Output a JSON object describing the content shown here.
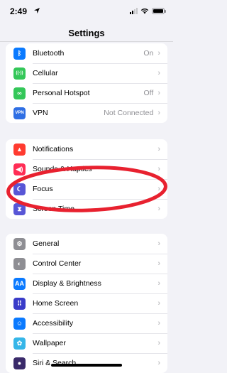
{
  "status_bar": {
    "time": "2:49"
  },
  "nav": {
    "title": "Settings"
  },
  "groups": [
    [
      {
        "name": "bluetooth",
        "label": "Bluetooth",
        "value": "On",
        "color": "#0a7aff",
        "icon": "bluetooth-icon",
        "glyph": "ᛒ"
      },
      {
        "name": "cellular",
        "label": "Cellular",
        "value": "",
        "color": "#34c759",
        "icon": "antenna-icon",
        "glyph": "((·))"
      },
      {
        "name": "personal-hotspot",
        "label": "Personal Hotspot",
        "value": "Off",
        "color": "#34c759",
        "icon": "link-icon",
        "glyph": "∞"
      },
      {
        "name": "vpn",
        "label": "VPN",
        "value": "Not Connected",
        "color": "#2f6fe4",
        "icon": "vpn-icon",
        "glyph": "VPN"
      }
    ],
    [
      {
        "name": "notifications",
        "label": "Notifications",
        "value": "",
        "color": "#ff3b30",
        "icon": "bell-icon",
        "glyph": "▲"
      },
      {
        "name": "sounds-haptics",
        "label": "Sounds & Haptics",
        "value": "",
        "color": "#ff2d55",
        "icon": "speaker-icon",
        "glyph": "◀)"
      },
      {
        "name": "focus",
        "label": "Focus",
        "value": "",
        "color": "#5856d6",
        "icon": "moon-icon",
        "glyph": "☾"
      },
      {
        "name": "screen-time",
        "label": "Screen Time",
        "value": "",
        "color": "#5856d6",
        "icon": "hourglass-icon",
        "glyph": "⧗"
      }
    ],
    [
      {
        "name": "general",
        "label": "General",
        "value": "",
        "color": "#8e8e93",
        "icon": "gear-icon",
        "glyph": "⚙"
      },
      {
        "name": "control-center",
        "label": "Control Center",
        "value": "",
        "color": "#8e8e93",
        "icon": "toggles-icon",
        "glyph": "◐"
      },
      {
        "name": "display-brightness",
        "label": "Display & Brightness",
        "value": "",
        "color": "#0a7aff",
        "icon": "text-size-icon",
        "glyph": "AA"
      },
      {
        "name": "home-screen",
        "label": "Home Screen",
        "value": "",
        "color": "#3a3cc9",
        "icon": "app-grid-icon",
        "glyph": "⠿"
      },
      {
        "name": "accessibility",
        "label": "Accessibility",
        "value": "",
        "color": "#0a7aff",
        "icon": "accessibility-icon",
        "glyph": "☺"
      },
      {
        "name": "wallpaper",
        "label": "Wallpaper",
        "value": "",
        "color": "#36b6e8",
        "icon": "flower-icon",
        "glyph": "✿"
      },
      {
        "name": "siri-search",
        "label": "Siri & Search",
        "value": "",
        "color": "#3a2a6a",
        "icon": "siri-icon",
        "glyph": "●"
      }
    ]
  ],
  "chevron": "›",
  "annotation": {
    "color": "#e8212f"
  }
}
